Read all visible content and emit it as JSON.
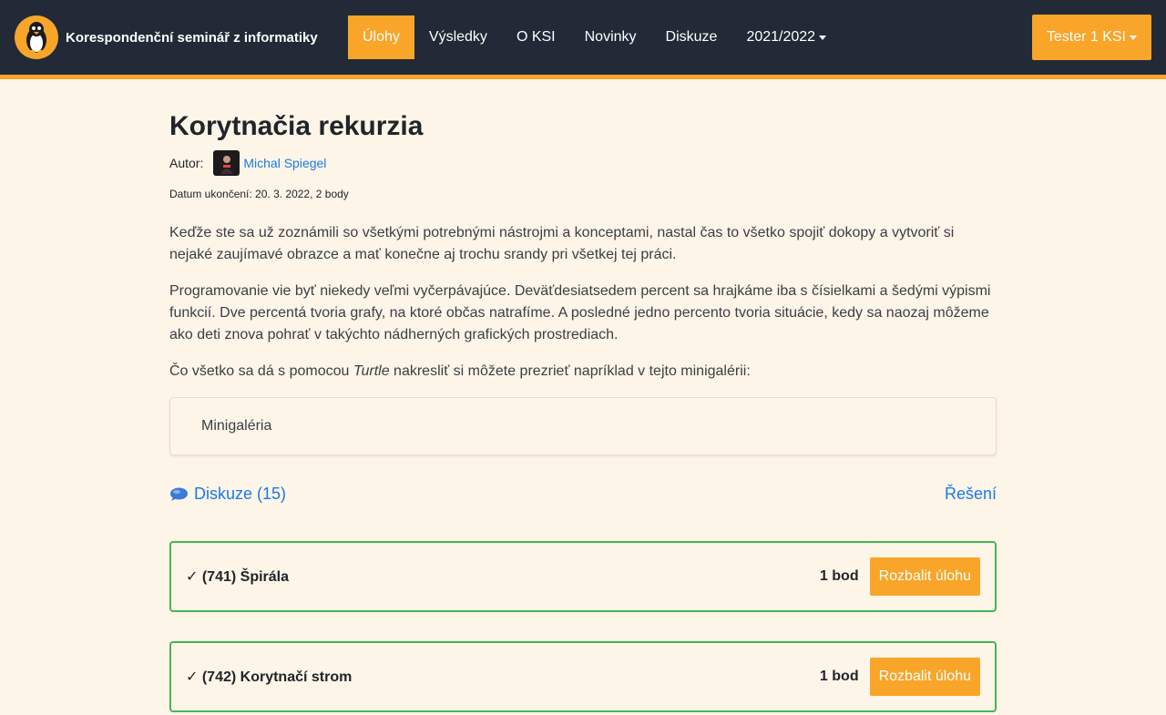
{
  "navbar": {
    "brand": "Korespondenční seminář z informatiky",
    "links": [
      "Úlohy",
      "Výsledky",
      "O KSI",
      "Novinky",
      "Diskuze",
      "2021/2022"
    ],
    "user": "Tester 1 KSI"
  },
  "page": {
    "title": "Korytnačia rekurzia",
    "author_label": "Autor:",
    "author_name": "Michal Spiegel",
    "deadline": "Datum ukončení: 20. 3. 2022, 2 body",
    "para1": "Keďže ste sa už zoznámili so všetkými potrebnými nástrojmi a konceptami, nastal čas to všetko spojiť dokopy a vytvoriť si nejaké zaujímavé obrazce a mať konečne aj trochu srandy pri všetkej tej práci.",
    "para2": "Programovanie vie byť niekedy veľmi vyčerpávajúce. Deväťdesiatsedem percent sa hrajkáme iba s čísielkami a šedými výpismi funkcií. Dve percentá tvoria grafy, na ktoré občas natrafíme. A posledné jedno percento tvoria situácie, kedy sa naozaj môžeme ako deti znova pohrať v takýchto nádherných grafických prostrediach.",
    "para3_before": "Čo všetko sa dá s pomocou ",
    "para3_em": "Turtle",
    "para3_after": " nakresliť si môžete prezrieť napríklad v tejto minigalérii:",
    "gallery_label": "Minigaléria",
    "discussion": "Diskuze (15)",
    "solution": "Řešení"
  },
  "tasks": [
    {
      "title": "✓ (741) Špirála",
      "points": "1 bod",
      "button": "Rozbalit úlohu"
    },
    {
      "title": "✓ (742) Korytnačí strom",
      "points": "1 bod",
      "button": "Rozbalit úlohu"
    }
  ],
  "colors": {
    "accent": "#f8a529",
    "navbar": "#212a36",
    "background": "#fef5e9",
    "link": "#1a7ae6",
    "success": "#47b35a"
  }
}
